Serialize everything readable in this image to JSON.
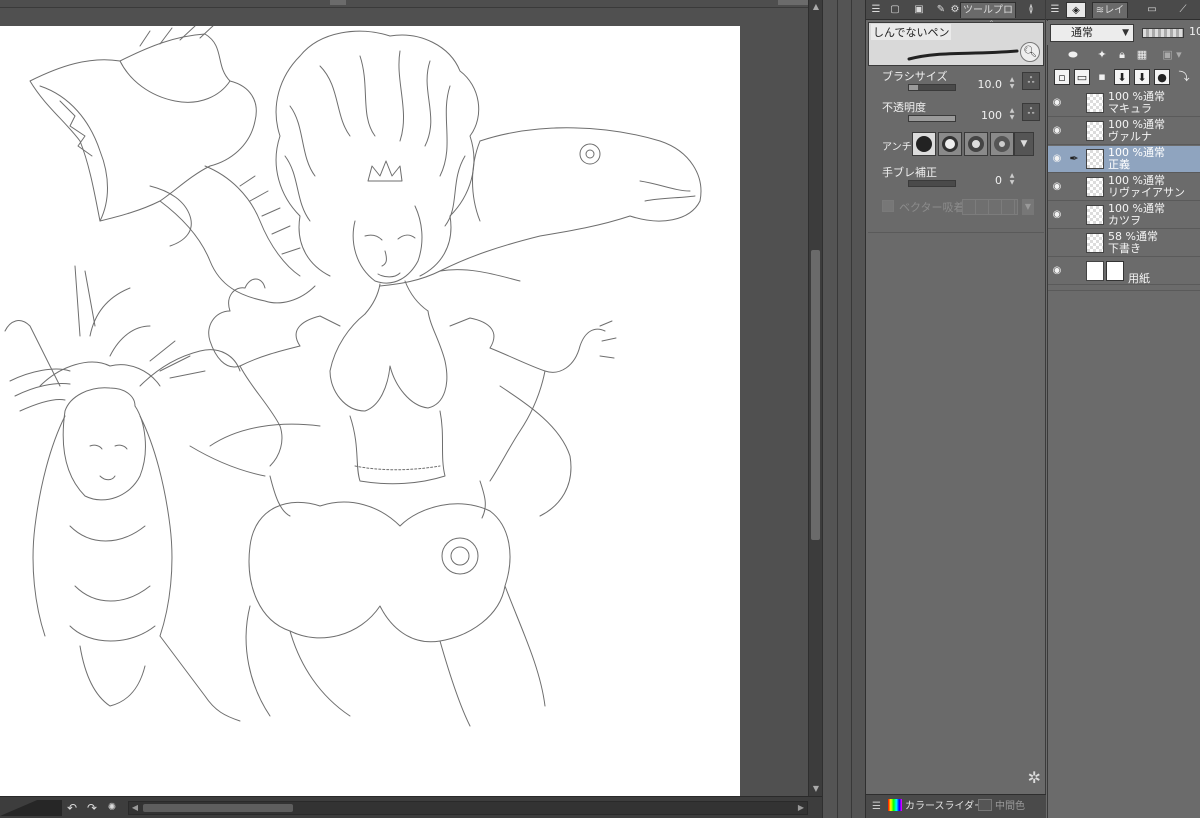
{
  "tool_panel": {
    "tab_label": "ツールプロパ",
    "brush_name": "しんでないペン",
    "properties": [
      {
        "label": "ブラシサイズ",
        "value": "10.0",
        "fraction": 0.2
      },
      {
        "label": "不透明度",
        "value": "100",
        "fraction": 1.0
      },
      {
        "label": "手ブレ補正",
        "value": "0",
        "fraction": 0.0
      }
    ],
    "antialias_label": "アンチ",
    "vector_label": "ベクター吸着",
    "color_tab_label": "カラースライダー",
    "middle_color_label": "中間色"
  },
  "layer_panel": {
    "tab_label": "レイ",
    "blend_mode": "通常",
    "opacity": "10",
    "layers": [
      {
        "line1": "100 %通常",
        "line2": "マキュラ",
        "visible": true,
        "selected": false,
        "editing": false
      },
      {
        "line1": "100 %通常",
        "line2": "ヴァルナ",
        "visible": true,
        "selected": false,
        "editing": false
      },
      {
        "line1": "100 %通常",
        "line2": "正義",
        "visible": true,
        "selected": true,
        "editing": true
      },
      {
        "line1": "100 %通常",
        "line2": "リヴァイアサン",
        "visible": true,
        "selected": false,
        "editing": false
      },
      {
        "line1": "100 %通常",
        "line2": "カツヲ",
        "visible": true,
        "selected": false,
        "editing": false
      },
      {
        "line1": "58 %通常",
        "line2": "下書き",
        "visible": false,
        "selected": false,
        "editing": false
      },
      {
        "line1": "",
        "line2": "用紙",
        "visible": true,
        "selected": false,
        "editing": false,
        "paper": true
      }
    ]
  },
  "colors": {
    "selected_layer": "#8fa4bf",
    "panel_bg": "#6a6a6a",
    "canvas_bg": "#ffffff"
  },
  "icons": {
    "eye": "eye-icon",
    "pen": "pen-icon",
    "search": "search-icon",
    "settings": "gear-icon",
    "undo": "undo-icon",
    "redo": "redo-icon"
  }
}
